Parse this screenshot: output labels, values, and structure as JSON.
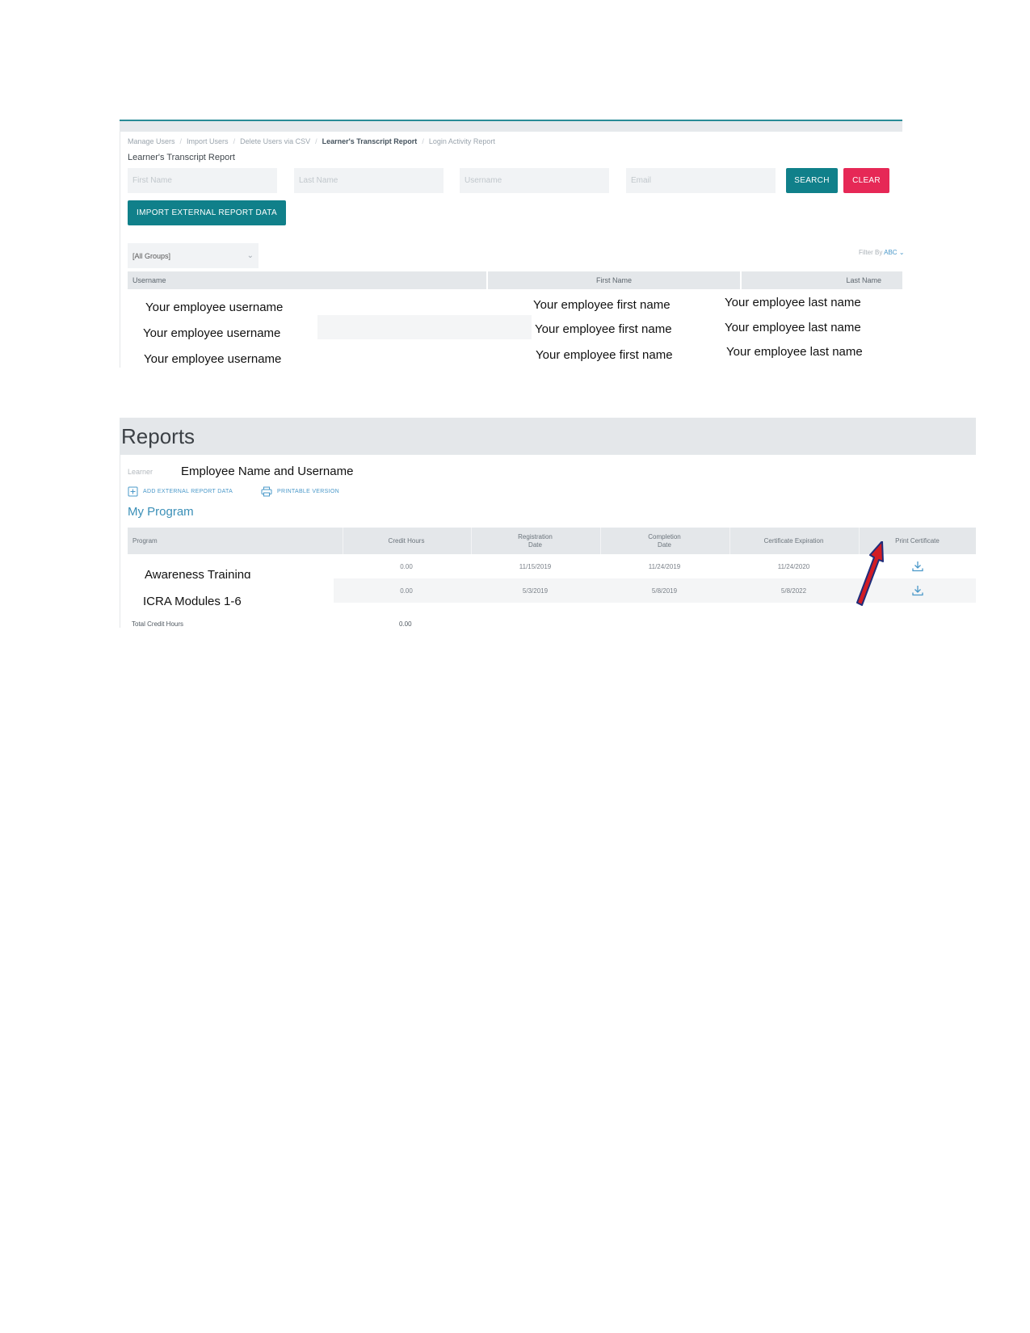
{
  "transcript": {
    "breadcrumbs": [
      "Manage Users",
      "Import Users",
      "Delete Users via CSV",
      "Learner's Transcript Report",
      "Login Activity Report"
    ],
    "title": "Learner's Transcript Report",
    "placeholders": {
      "first_name": "First Name",
      "last_name": "Last Name",
      "username": "Username",
      "email": "Email"
    },
    "search_label": "SEARCH",
    "clear_label": "CLEAR",
    "import_label": "IMPORT EXTERNAL REPORT DATA",
    "group_value": "[All Groups]",
    "filter_label": "Filter By",
    "filter_value": "ABC",
    "columns": {
      "username": "Username",
      "first_name": "First Name",
      "last_name": "Last Name"
    },
    "rows": [
      {
        "username": "Your employee username",
        "first_name": "Your employee first name",
        "last_name": "Your employee last name"
      },
      {
        "username": "Your employee username",
        "first_name": "Your employee first name",
        "last_name": "Your employee last name"
      },
      {
        "username": "Your employee username",
        "first_name": "Your employee first name",
        "last_name": "Your employee last name"
      }
    ]
  },
  "reports": {
    "title": "Reports",
    "learner_label": "Learner",
    "learner_value": "Employee Name and Username",
    "add_external_label": "ADD EXTERNAL REPORT DATA",
    "printable_label": "PRINTABLE VERSION",
    "section_title": "My Program",
    "columns": {
      "program": "Program",
      "credit_hours": "Credit Hours",
      "registration_line1": "Registration",
      "registration_line2": "Date",
      "completion_line1": "Completion",
      "completion_line2": "Date",
      "expiration": "Certificate Expiration",
      "print": "Print Certificate"
    },
    "programs": [
      {
        "name": "Awareness Training",
        "credit_hours": "0.00",
        "registration": "11/15/2019",
        "completion": "11/24/2019",
        "expiration": "11/24/2020",
        "print_icon": "download-icon"
      },
      {
        "name": "ICRA Modules 1-6",
        "credit_hours": "0.00",
        "registration": "5/3/2019",
        "completion": "5/8/2019",
        "expiration": "5/8/2022",
        "print_icon": "download-icon"
      }
    ],
    "total_label": "Total Credit Hours",
    "total_value": "0.00"
  },
  "colors": {
    "teal": "#10808a",
    "red": "#e62856",
    "link": "#4a98c9",
    "arrow_fill": "#d21c24",
    "arrow_outline": "#1f2d7a"
  }
}
